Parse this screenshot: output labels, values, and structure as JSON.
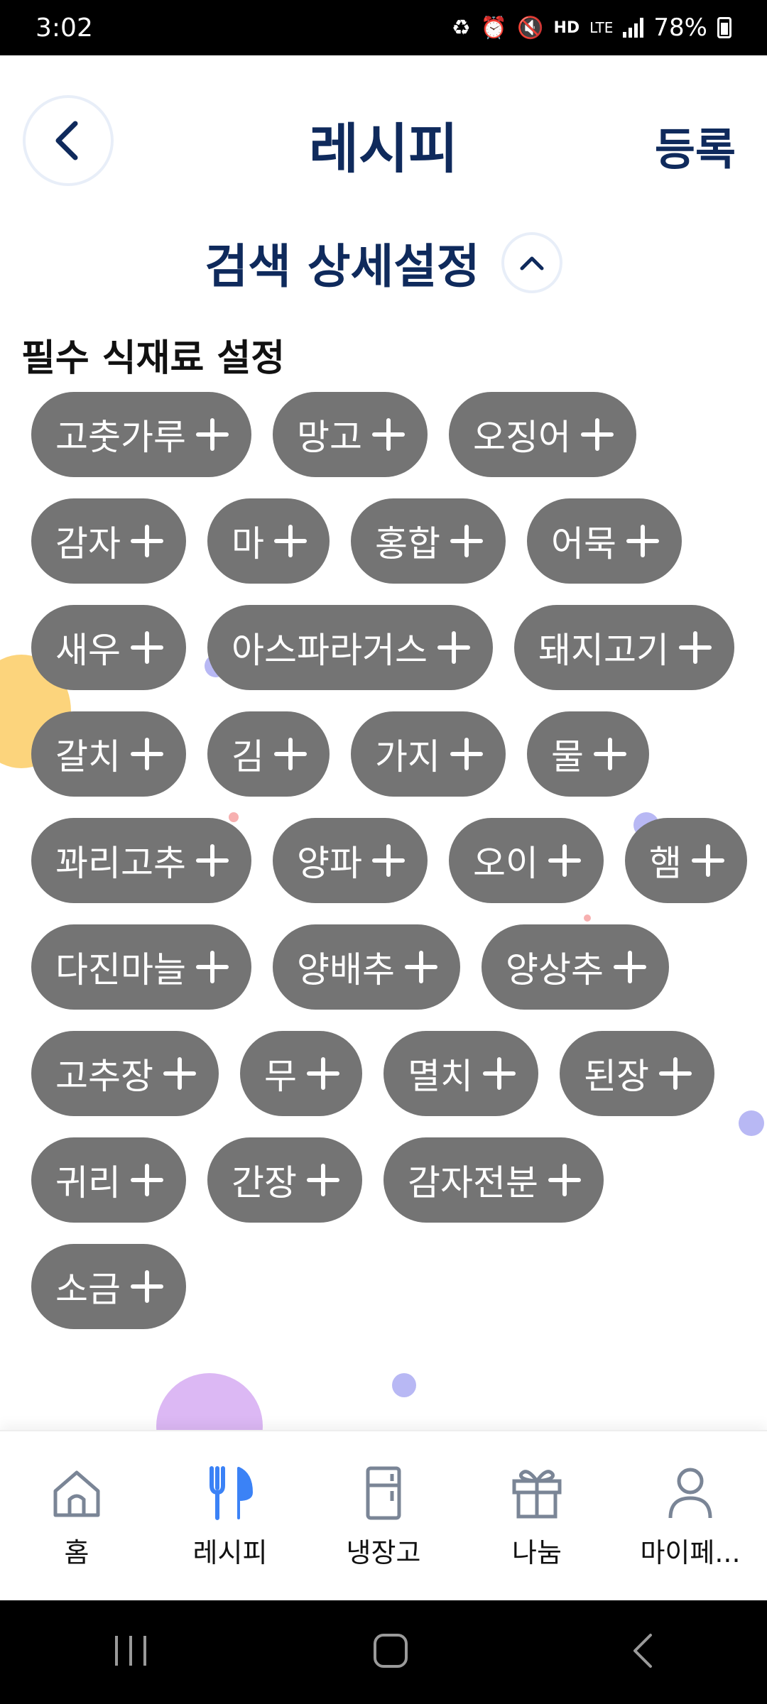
{
  "status_bar": {
    "time": "3:02",
    "battery": "78%",
    "network": "LTE",
    "hd": "HD"
  },
  "header": {
    "title": "레시피",
    "register_label": "등록"
  },
  "search_detail": {
    "title": "검색 상세설정"
  },
  "section": {
    "title": "필수 식재료 설정"
  },
  "ingredients": [
    "고춧가루",
    "망고",
    "오징어",
    "감자",
    "마",
    "홍합",
    "어묵",
    "새우",
    "아스파라거스",
    "돼지고기",
    "갈치",
    "김",
    "가지",
    "물",
    "꽈리고추",
    "양파",
    "오이",
    "햄",
    "다진마늘",
    "양배추",
    "양상추",
    "고추장",
    "무",
    "멸치",
    "된장",
    "귀리",
    "간장",
    "감자전분",
    "소금"
  ],
  "bottom_nav": {
    "items": [
      {
        "label": "홈",
        "icon": "home-icon"
      },
      {
        "label": "레시피",
        "icon": "utensils-icon"
      },
      {
        "label": "냉장고",
        "icon": "fridge-icon"
      },
      {
        "label": "나눔",
        "icon": "gift-icon"
      },
      {
        "label": "마이페...",
        "icon": "user-icon"
      }
    ],
    "active_index": 1
  },
  "colors": {
    "primary": "#0f2a5c",
    "chip_bg": "#747474",
    "active_nav": "#3b82f6",
    "inactive_nav": "#7a8596"
  }
}
